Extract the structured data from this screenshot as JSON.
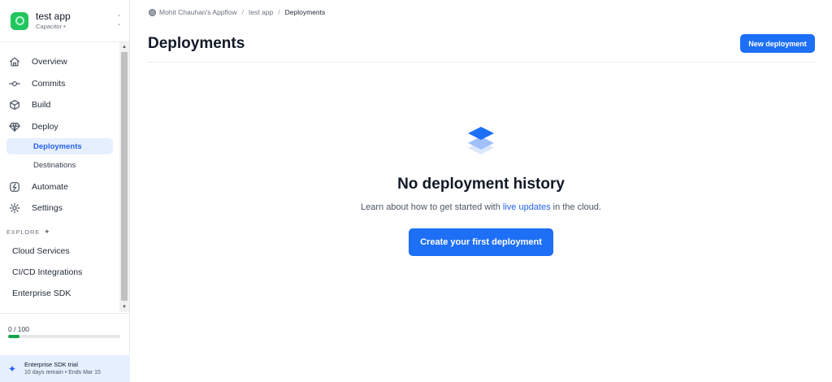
{
  "app": {
    "name": "test app",
    "platform": "Capacitor •",
    "icon": "app-icon",
    "switcher_icon": "chevron-up-down-icon"
  },
  "sidebar": {
    "nav": [
      {
        "label": "Overview",
        "icon": "home-icon"
      },
      {
        "label": "Commits",
        "icon": "commit-icon"
      },
      {
        "label": "Build",
        "icon": "cube-icon"
      },
      {
        "label": "Deploy",
        "icon": "diamond-icon"
      }
    ],
    "deploy_sub": [
      {
        "label": "Deployments",
        "active": true
      },
      {
        "label": "Destinations",
        "active": false
      }
    ],
    "nav_lower": [
      {
        "label": "Automate",
        "icon": "automate-icon"
      },
      {
        "label": "Settings",
        "icon": "gear-icon"
      }
    ],
    "explore": {
      "heading": "EXPLORE",
      "icon": "sparkle-icon",
      "items": [
        "Cloud Services",
        "CI/CD Integrations",
        "Enterprise SDK"
      ]
    },
    "usage": {
      "text": "0 / 100",
      "progress": 0.1
    },
    "trial": {
      "title": "Enterprise SDK trial",
      "subtitle": "10 days remain • Ends Mar 15",
      "icon": "sparkle-icon"
    }
  },
  "breadcrumb": {
    "org": "Mohit Chauhan's Appflow",
    "app": "test app",
    "current": "Deployments",
    "separator": "/"
  },
  "page": {
    "title": "Deployments",
    "new_button": "New deployment"
  },
  "empty_state": {
    "icon": "layers-icon",
    "title": "No deployment history",
    "desc_before": "Learn about how to get started with ",
    "link": "live updates",
    "desc_after": " in the cloud.",
    "button": "Create your first deployment"
  },
  "colors": {
    "accent": "#1d6ff5",
    "active_bg": "#e6effd",
    "app_icon": "#22c55e",
    "progress": "#16a34a"
  }
}
